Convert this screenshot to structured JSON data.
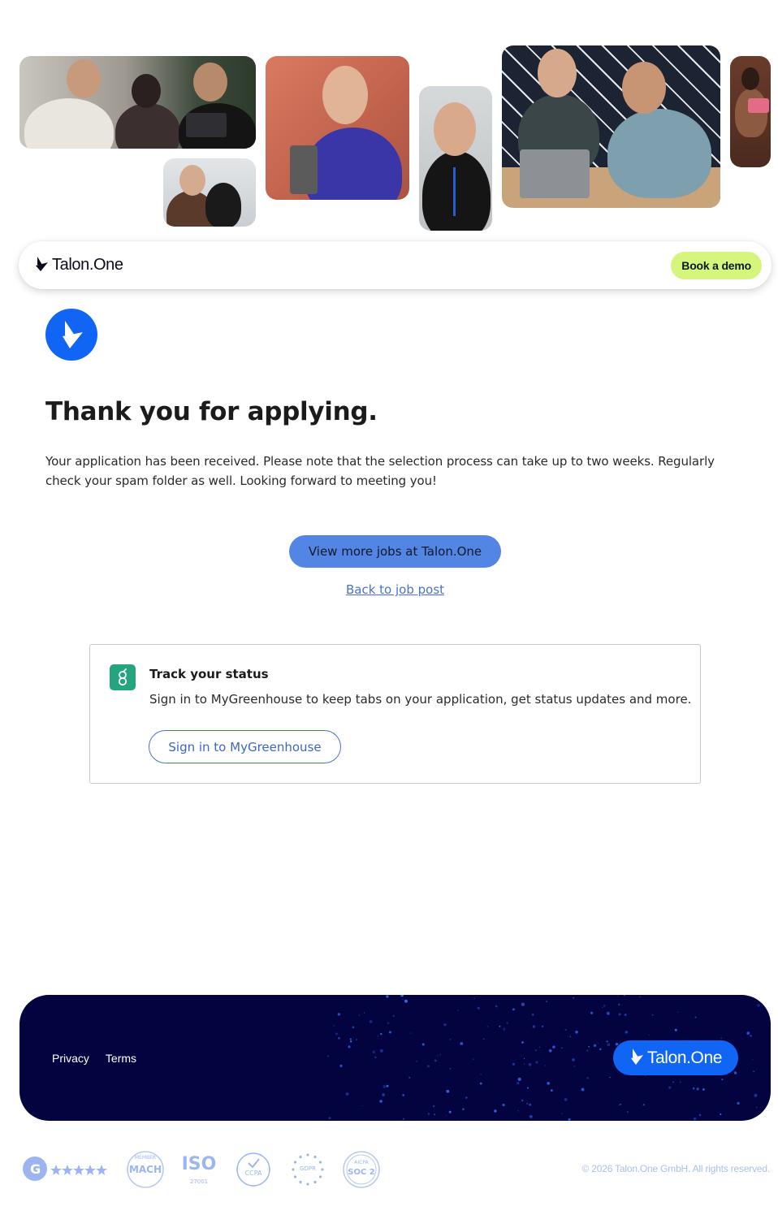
{
  "header": {
    "brand_name": "Talon.One",
    "demo_button": "Book a demo"
  },
  "main": {
    "title": "Thank you for applying.",
    "intro": "Your application has been received. Please note that the selection process can take up to two weeks. Regularly check your spam folder as well. Looking forward to meeting you!",
    "jobs_button": "View more jobs at Talon.One",
    "back_link": "Back to job post"
  },
  "track": {
    "title": "Track your status",
    "description": "Sign in to MyGreenhouse to keep tabs on your application, get status updates and more.",
    "signin_button": "Sign in to MyGreenhouse"
  },
  "footer": {
    "links": [
      "Privacy",
      "Terms"
    ],
    "brand_name": "Talon.One",
    "copyright": "© 2026 Talon.One GmbH. All rights reserved."
  },
  "badges": {
    "iso_label": "ISO",
    "iso_number": "27001",
    "ccpa": "CCPA",
    "gdpr": "GDPR",
    "soc_top": "AICPA",
    "soc": "SOC 2",
    "mach_top": "MEMBER",
    "mach": "MACH"
  },
  "icons": [
    "talon-logo-icon",
    "greenhouse-icon",
    "g2-icon",
    "star-icon"
  ],
  "colors": {
    "brand_blue": "#1065f5",
    "demo_green": "#d6f57d",
    "footer_navy": "#03033f",
    "link_blue": "#4b72c9",
    "greenhouse_green": "#24a47f"
  }
}
